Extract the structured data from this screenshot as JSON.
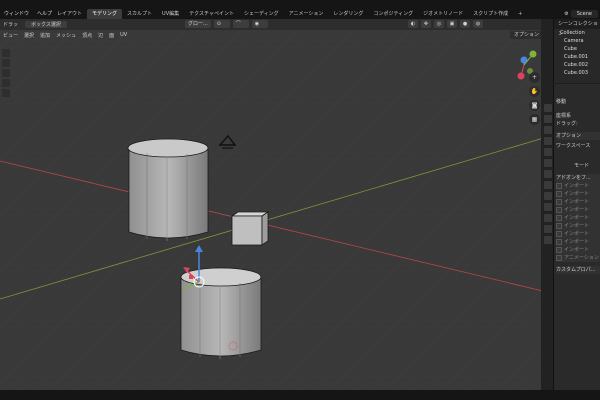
{
  "topbar": {
    "menu": [
      "ウィンドウ",
      "ヘルプ"
    ],
    "tabs": [
      "レイアウト",
      "モデリング",
      "スカルプト",
      "UV編集",
      "テクスチャペイント",
      "シェーディング",
      "アニメーション",
      "レンダリング",
      "コンポジティング",
      "ジオメトリノード",
      "スクリプト作成",
      "+"
    ],
    "active_tab": "モデリング",
    "scene": "Scene"
  },
  "viewport_header": {
    "items": [
      "ドラッ",
      "ボックス選択",
      "ビュー",
      "選択",
      "追加",
      "メッシュ",
      "頂点",
      "辺",
      "面",
      "UV"
    ],
    "transform_orientation": "グロー...",
    "options_label": "オプション"
  },
  "outliner": {
    "title": "シーンコレクション",
    "items": [
      "Collection",
      "Camera",
      "Cube",
      "Cube.001",
      "Cube.002",
      "Cube.003"
    ]
  },
  "properties": {
    "tool_label": "移動",
    "section_label": "座標系",
    "drag_label": "ドラッグ:",
    "options": "オプション",
    "workspace": "ワークスペース",
    "mode": "モード",
    "addons_header": "アドオンをフ...",
    "addon_items": [
      "インポート",
      "インポート",
      "インポート",
      "インポート",
      "インポート",
      "インポート",
      "インポート",
      "インポート",
      "インポート",
      "アニメーション"
    ],
    "custom_props": "カスタムプロパ..."
  },
  "colors": {
    "viewport_bg": "#393939",
    "accent": "#4772b3",
    "x_axis": "#c0504d",
    "y_axis": "#7a9a3a"
  }
}
